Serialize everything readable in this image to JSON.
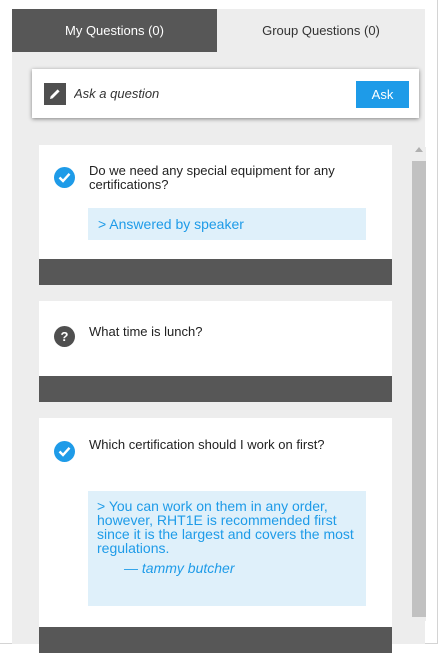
{
  "tabs": [
    {
      "label": "My Questions (0)",
      "active": true
    },
    {
      "label": "Group Questions (0)",
      "active": false
    }
  ],
  "ask_bar": {
    "placeholder": "Ask a question",
    "button_label": "Ask"
  },
  "questions": [
    {
      "text": "Do we need any special equipment for any certifications?",
      "status": "answered",
      "answer": "> Answered by speaker"
    },
    {
      "text": "What time is lunch?",
      "status": "pending",
      "status_symbol": "?"
    },
    {
      "text": "Which certification should I work on first?",
      "status": "answered",
      "answer": "> You can work on them in any order, however, RHT1E is recommended first since it is the largest and covers the most regulations.",
      "answer_author": "— tammy butcher"
    }
  ],
  "colors": {
    "accent": "#1e9be8",
    "dark": "#575757",
    "panel": "#ededed",
    "answer_bg": "#dff0fa"
  },
  "icons": {
    "pencil": "pencil-icon",
    "answered": "checkmark-circle-icon",
    "pending": "question-circle-icon"
  }
}
